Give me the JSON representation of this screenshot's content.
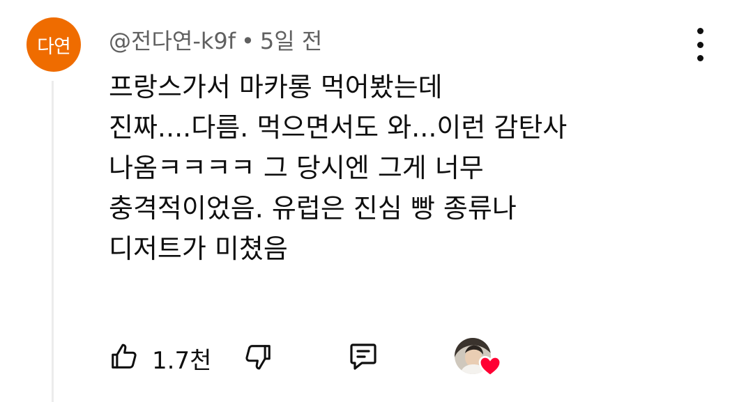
{
  "comment": {
    "avatar_initials": "다연",
    "author": "@전다연-k9f",
    "separator": "•",
    "timestamp": "5일 전",
    "lines": [
      "프랑스가서 마카롱 먹어봤는데",
      "진짜....다름. 먹으면서도 와...이런 감탄사",
      "나옴ㅋㅋㅋㅋ 그 당시엔 그게 너무",
      "충격적이었음. 유럽은 진심 빵 종류나",
      "디저트가 미쳤음"
    ],
    "like_count": "1.7천"
  },
  "icons": {
    "menu": "more-vertical-icon",
    "like": "thumbs-up-icon",
    "dislike": "thumbs-down-icon",
    "reply": "reply-comment-icon",
    "creator_heart": "heart-icon"
  },
  "colors": {
    "avatar_bg": "#ef6c00",
    "text": "#0f0f0f",
    "meta_text": "#606060",
    "heart": "#ff0033"
  }
}
